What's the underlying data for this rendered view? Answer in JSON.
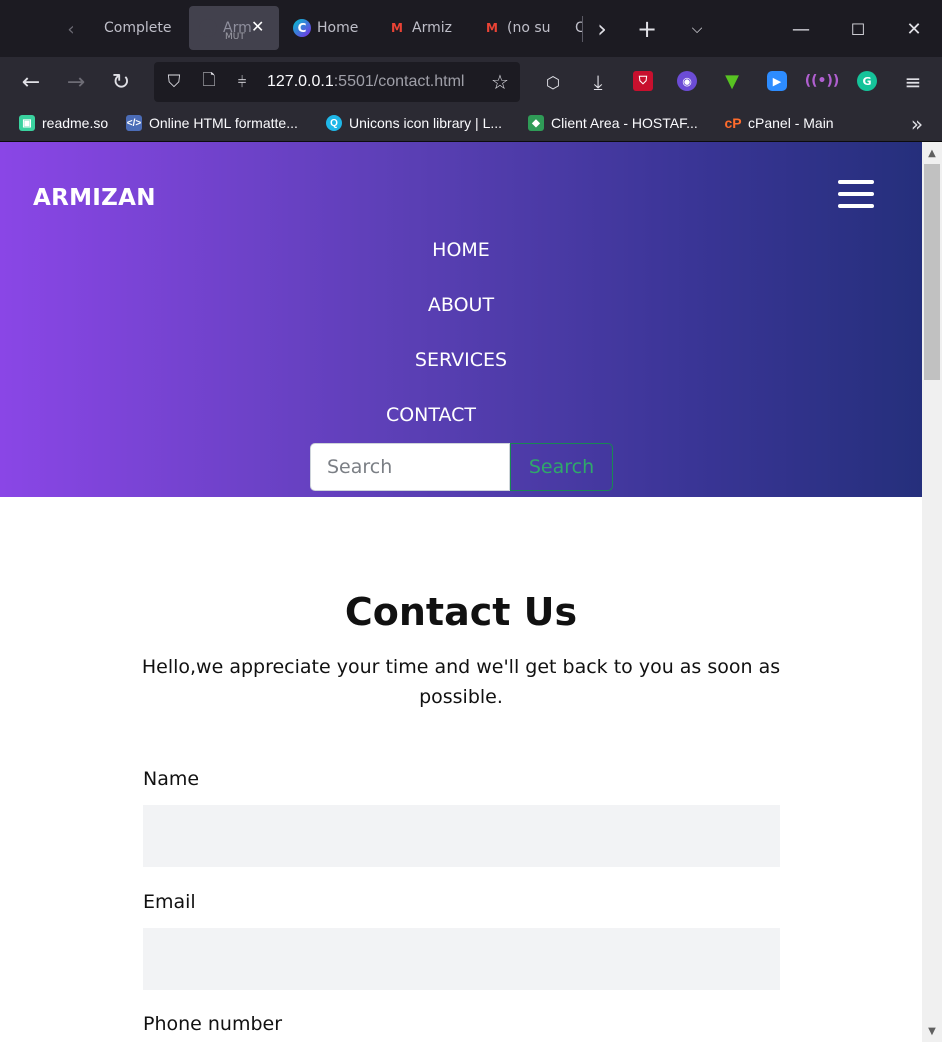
{
  "browser": {
    "tabs": [
      {
        "label": "Complete"
      },
      {
        "label": "Arm",
        "sub": "MUT",
        "active": true
      },
      {
        "label": "Home"
      },
      {
        "label": "Armiz"
      },
      {
        "label": "(no su"
      },
      {
        "label": "C"
      }
    ],
    "url": {
      "host": "127.0.0.1",
      "rest": ":5501/contact.html"
    },
    "bookmarks": [
      {
        "label": "readme.so",
        "icon": "readme-icon",
        "color": "#3ad29f"
      },
      {
        "label": "Online HTML formatte...",
        "icon": "code-icon",
        "color": "#4b6cb7"
      },
      {
        "label": "Unicons icon library | L...",
        "icon": "unicons-icon",
        "color": "#1fb7e8"
      },
      {
        "label": "Client Area - HOSTAF...",
        "icon": "hostaf-icon",
        "color": "#2f9b57"
      },
      {
        "label": "cPanel - Main",
        "icon": "cpanel-icon",
        "color": "#ff6c2c"
      }
    ]
  },
  "site": {
    "brand": "ARMIZAN",
    "nav": [
      "HOME",
      "ABOUT",
      "SERVICES",
      "CONTACT"
    ],
    "search": {
      "placeholder": "Search",
      "button": "Search"
    },
    "contact": {
      "title": "Contact Us",
      "subtitle": "Hello,we appreciate your time and we'll get back to you as soon as possible.",
      "fields": [
        {
          "label": "Name",
          "value": ""
        },
        {
          "label": "Email",
          "value": ""
        },
        {
          "label": "Phone number",
          "value": ""
        }
      ]
    },
    "colors": {
      "gradient_start": "#8a46e6",
      "gradient_end": "#252f7c",
      "search_button": "#198754"
    }
  }
}
